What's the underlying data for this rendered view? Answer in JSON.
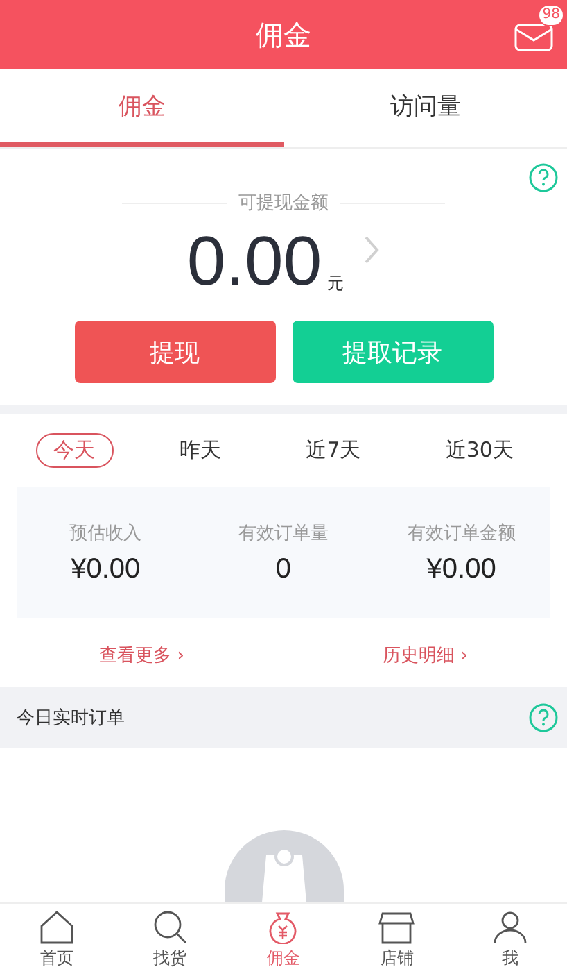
{
  "header": {
    "title": "佣金",
    "badge": "98"
  },
  "tabs": [
    {
      "label": "佣金",
      "selected": true
    },
    {
      "label": "访问量",
      "selected": false
    }
  ],
  "balance": {
    "label": "可提现金额",
    "amount": "0.00",
    "unit": "元"
  },
  "actions": [
    {
      "label": "提现",
      "kind": "primary"
    },
    {
      "label": "提取记录",
      "kind": "secondary"
    }
  ],
  "periods": [
    {
      "label": "今天",
      "selected": true
    },
    {
      "label": "昨天",
      "selected": false
    },
    {
      "label": "近7天",
      "selected": false
    },
    {
      "label": "近30天",
      "selected": false
    }
  ],
  "stats": [
    {
      "label": "预估收入",
      "value": "¥0.00"
    },
    {
      "label": "有效订单量",
      "value": "0"
    },
    {
      "label": "有效订单金额",
      "value": "¥0.00"
    }
  ],
  "links": [
    "查看更多 ›",
    "历史明细 ›"
  ],
  "section": {
    "title": "今日实时订单"
  },
  "nav": [
    {
      "label": "首页",
      "kind": "home",
      "selected": false
    },
    {
      "label": "找货",
      "kind": "search",
      "selected": false
    },
    {
      "label": "佣金",
      "kind": "money",
      "selected": true
    },
    {
      "label": "店铺",
      "kind": "store",
      "selected": false
    },
    {
      "label": "我",
      "kind": "user",
      "selected": false
    }
  ]
}
